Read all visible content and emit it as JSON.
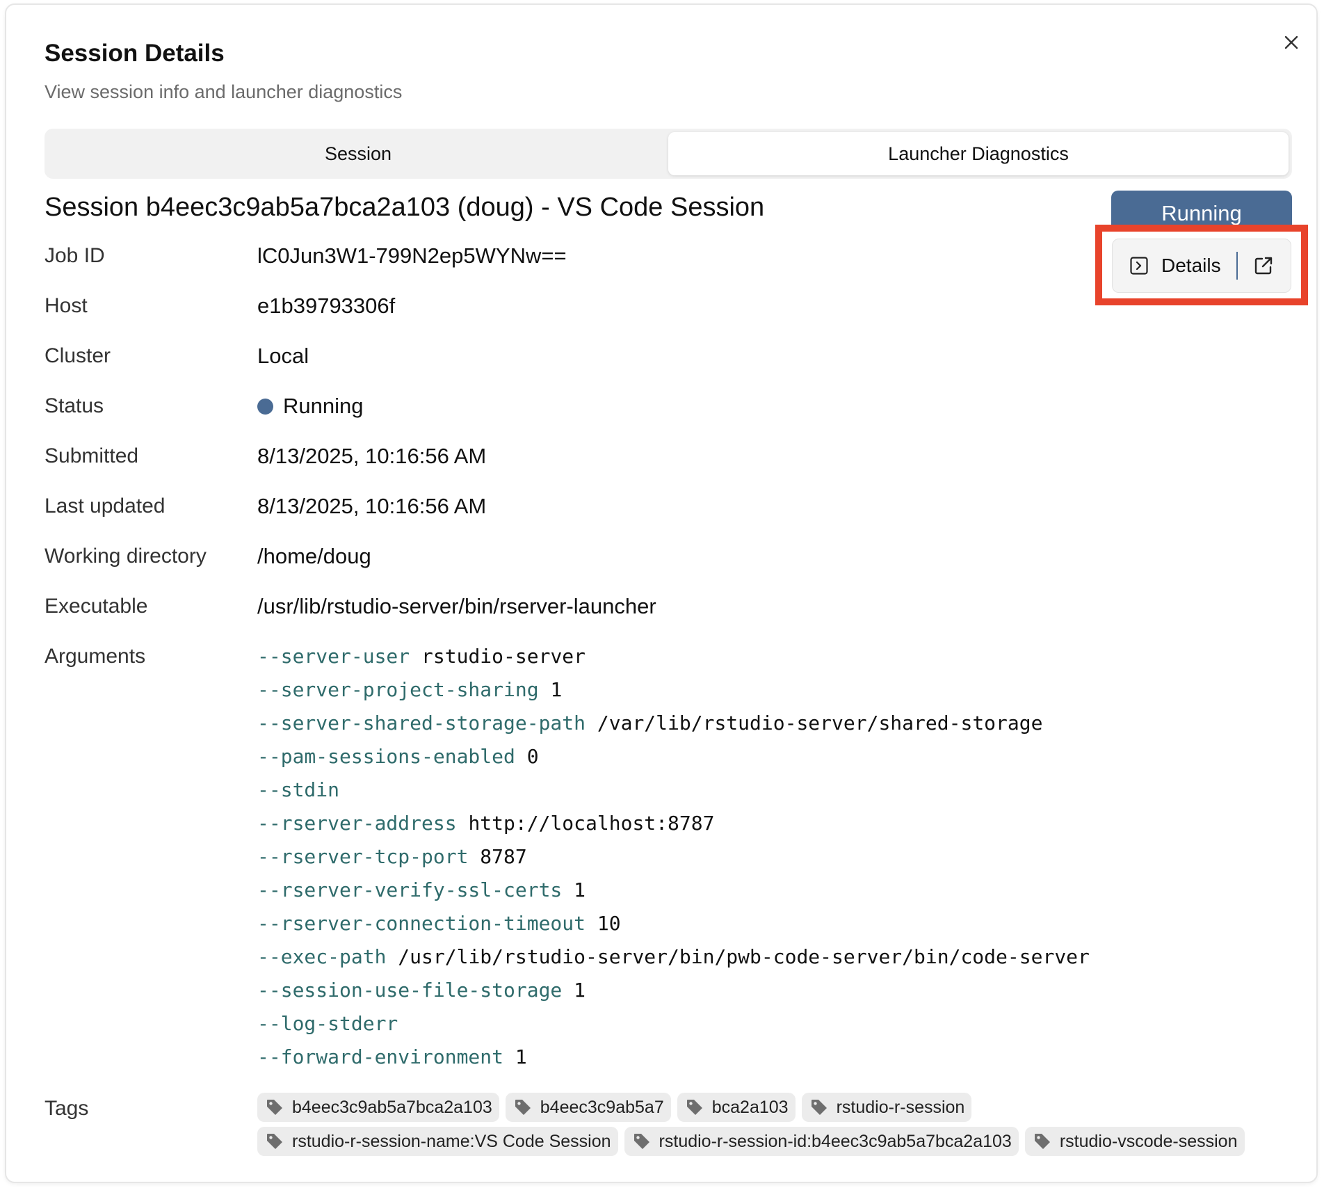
{
  "dialog": {
    "title": "Session Details",
    "subtitle": "View session info and launcher diagnostics",
    "close_icon": "close-icon"
  },
  "tabs": [
    {
      "label": "Session",
      "active": false
    },
    {
      "label": "Launcher Diagnostics",
      "active": true
    }
  ],
  "session": {
    "heading": "Session b4eec3c9ab5a7bca2a103 (doug) - VS Code Session",
    "status_badge": "Running",
    "details_button": "Details",
    "status_color": "#4a6b94"
  },
  "fields": {
    "job_id": {
      "label": "Job ID",
      "value": "lC0Jun3W1-799N2ep5WYNw=="
    },
    "host": {
      "label": "Host",
      "value": "e1b39793306f"
    },
    "cluster": {
      "label": "Cluster",
      "value": "Local"
    },
    "status": {
      "label": "Status",
      "value": "Running"
    },
    "submitted": {
      "label": "Submitted",
      "value": "8/13/2025, 10:16:56 AM"
    },
    "last_updated": {
      "label": "Last updated",
      "value": "8/13/2025, 10:16:56 AM"
    },
    "working_directory": {
      "label": "Working directory",
      "value": "/home/doug"
    },
    "executable": {
      "label": "Executable",
      "value": "/usr/lib/rstudio-server/bin/rserver-launcher"
    },
    "arguments": {
      "label": "Arguments"
    },
    "tags": {
      "label": "Tags"
    }
  },
  "arguments": [
    {
      "flag": "--server-user",
      "value": "rstudio-server"
    },
    {
      "flag": "--server-project-sharing",
      "value": "1"
    },
    {
      "flag": "--server-shared-storage-path",
      "value": "/var/lib/rstudio-server/shared-storage"
    },
    {
      "flag": "--pam-sessions-enabled",
      "value": "0"
    },
    {
      "flag": "--stdin",
      "value": ""
    },
    {
      "flag": "--rserver-address",
      "value": "http://localhost:8787"
    },
    {
      "flag": "--rserver-tcp-port",
      "value": "8787"
    },
    {
      "flag": "--rserver-verify-ssl-certs",
      "value": "1"
    },
    {
      "flag": "--rserver-connection-timeout",
      "value": "10"
    },
    {
      "flag": "--exec-path",
      "value": "/usr/lib/rstudio-server/bin/pwb-code-server/bin/code-server"
    },
    {
      "flag": "--session-use-file-storage",
      "value": "1"
    },
    {
      "flag": "--log-stderr",
      "value": ""
    },
    {
      "flag": "--forward-environment",
      "value": "1"
    }
  ],
  "tags": [
    [
      "b4eec3c9ab5a7bca2a103",
      "b4eec3c9ab5a7",
      "bca2a103",
      "rstudio-r-session"
    ],
    [
      "rstudio-r-session-name:VS Code Session",
      "rstudio-r-session-id:b4eec3c9ab5a7bca2a103",
      "rstudio-vscode-session"
    ]
  ],
  "colors": {
    "accent": "#4a6b94",
    "highlight": "#e8432b",
    "flag_text": "#2f6b6b"
  }
}
